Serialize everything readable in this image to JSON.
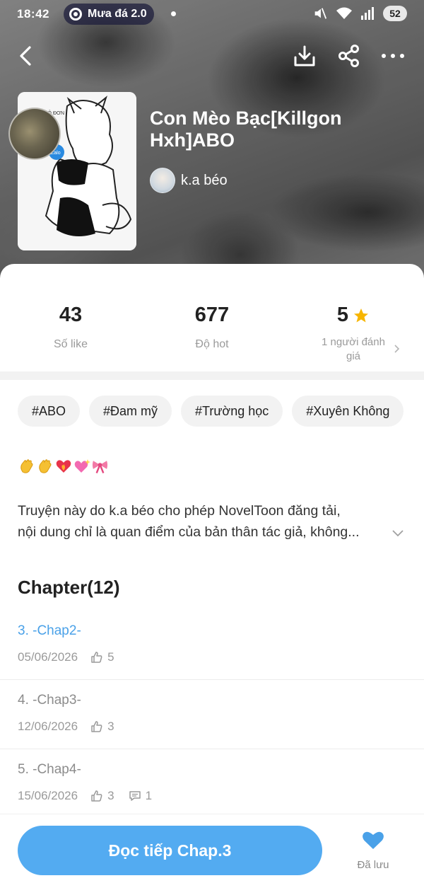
{
  "status_bar": {
    "time": "18:42",
    "weather_pill": "Mưa đá 2.0",
    "battery": "52"
  },
  "book": {
    "title": "Con Mèo Bạc[Killgon Hxh]ABO",
    "author": "k.a béo"
  },
  "stats": {
    "likes": {
      "value": "43",
      "label": "Số like"
    },
    "hot": {
      "value": "677",
      "label": "Độ hot"
    },
    "rating": {
      "value": "5",
      "label": "1 người đánh giá"
    }
  },
  "tags": [
    "#ABO",
    "#Đam mỹ",
    "#Trường học",
    "#Xuyên Không"
  ],
  "emoji_icons": [
    "waving-hand-icon",
    "waving-hand-icon",
    "heart-on-fire-icon",
    "sparkling-heart-icon",
    "ribbon-icon"
  ],
  "description": {
    "line1": "Truyện này do k.a béo cho phép NovelToon đăng tải,",
    "line2": "nội dung chỉ là quan điểm của bản thân tác giả, không..."
  },
  "chapters_header": "Chapter(12)",
  "chapters": [
    {
      "title": "3. -Chap2-",
      "date": "05/06/2026",
      "likes": "5",
      "comments": "",
      "current": true
    },
    {
      "title": "4. -Chap3-",
      "date": "12/06/2026",
      "likes": "3",
      "comments": "",
      "current": false
    },
    {
      "title": "5. -Chap4-",
      "date": "15/06/2026",
      "likes": "3",
      "comments": "1",
      "current": false
    }
  ],
  "bottom_bar": {
    "read_button": "Đọc tiếp Chap.3",
    "saved_label": "Đã lưu"
  },
  "colors": {
    "accent": "#53abf1",
    "current_chapter": "#4aa1e8",
    "star": "#f7b500",
    "saved_heart": "#4aa1e8"
  }
}
